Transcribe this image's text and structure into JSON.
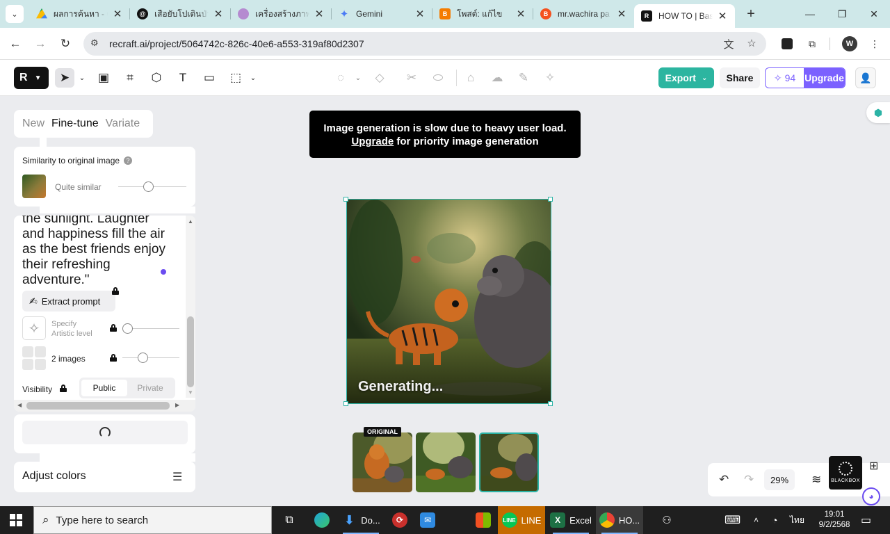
{
  "browser": {
    "tabs": [
      {
        "title": "ผลการค้นหา - G",
        "icon": "google-drive-icon",
        "color": "#1a73e8"
      },
      {
        "title": "เสือยับโปเดินป่า",
        "icon": "threads-icon",
        "color": "#111111"
      },
      {
        "title": "เครื่องสร้างภาพ A",
        "icon": "ai-image-icon",
        "color": "#8a4fb8"
      },
      {
        "title": "Gemini",
        "icon": "gemini-icon",
        "color": "#4b7bf5"
      },
      {
        "title": "โพสต์: แก้ไข",
        "icon": "blogger-icon",
        "color": "#f57c00"
      },
      {
        "title": "mr.wachira pa",
        "icon": "blogger-icon",
        "color": "#f4511e"
      },
      {
        "title": "HOW TO | Bas",
        "icon": "recraft-icon",
        "color": "#111111"
      }
    ],
    "url_host": "recraft.ai",
    "url_path": "/project/5064742c-826c-40e6-a553-319af80d2307",
    "profile_initial": "W"
  },
  "toolbar": {
    "export_label": "Export",
    "share_label": "Share",
    "credits": "94",
    "upgrade_label": "Upgrade"
  },
  "panel": {
    "mode_tabs": [
      "New",
      "Fine-tune",
      "Variate"
    ],
    "active_mode": "Fine-tune",
    "similarity_title": "Similarity to original image",
    "similarity_value": "Quite similar",
    "prompt_lines": [
      "the sunlight. Laughter",
      "and happiness fill the air",
      "as the best friends enjoy",
      "their refreshing",
      "adventure.\""
    ],
    "extract_label": "Extract prompt",
    "artistic_label_1": "Specify",
    "artistic_label_2": "Artistic level",
    "images_label": "2 images",
    "visibility_label": "Visibility",
    "visibility_options": [
      "Public",
      "Private"
    ],
    "visibility_selected": "Public",
    "adjust_colors_label": "Adjust colors"
  },
  "canvas": {
    "banner_line1": "Image generation is slow due to heavy user load.",
    "banner_link": "Upgrade",
    "banner_line2_rest": " for priority image generation",
    "generating_label": "Generating...",
    "original_badge": "ORIGINAL",
    "zoom": "29%",
    "blackbox_label": "BLACKBOX"
  },
  "taskbar": {
    "search_placeholder": "Type here to search",
    "apps": [
      {
        "label": "Do...",
        "icon": "download-icon"
      },
      {
        "label": "LINE",
        "icon": "line-icon"
      },
      {
        "label": "Excel",
        "icon": "excel-icon"
      },
      {
        "label": "HO...",
        "icon": "chrome-icon"
      }
    ],
    "lang": "ไทย",
    "time": "19:01",
    "date": "9/2/2568"
  }
}
